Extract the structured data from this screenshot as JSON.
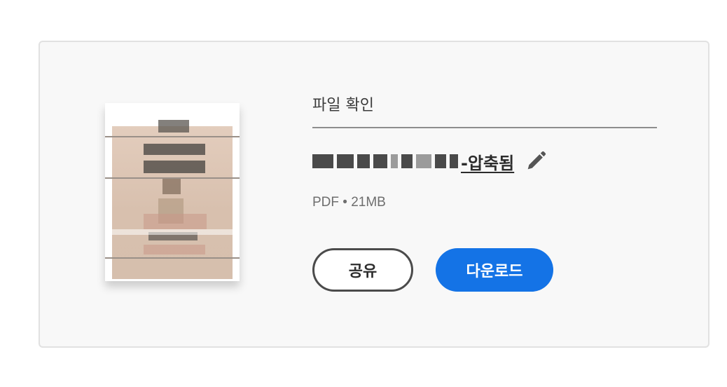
{
  "panel": {
    "section_title": "파일 확인",
    "file": {
      "name_visible_suffix": "-압축됨",
      "type": "PDF",
      "separator": "•",
      "size": "21MB"
    },
    "buttons": {
      "share": "공유",
      "download": "다운로드"
    },
    "icons": {
      "edit": "pencil-icon"
    },
    "colors": {
      "primary": "#1473e6",
      "card_bg": "#f8f8f8"
    }
  }
}
